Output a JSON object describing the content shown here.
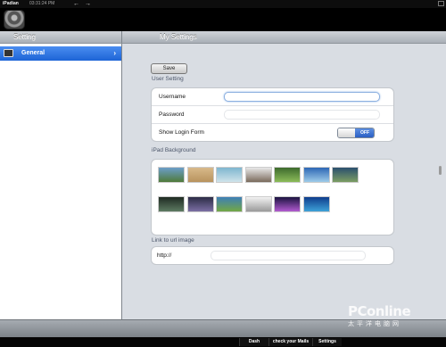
{
  "statusbar": {
    "app": "iPadian",
    "time": "03:31:24 PM",
    "arrows": "← →"
  },
  "sidebar": {
    "title": "Setting",
    "items": [
      {
        "label": "General",
        "selected": true
      }
    ]
  },
  "main": {
    "title": "My Settings",
    "save_label": "Save",
    "user_setting": {
      "title": "User Setting",
      "username_label": "Username",
      "username_value": "",
      "password_label": "Password",
      "password_value": "",
      "login_form_label": "Show Login Form",
      "login_form_state": "OFF"
    },
    "background": {
      "title": "iPad Background",
      "thumbnails": [
        {
          "name": "landscape-field",
          "colors": [
            "#6c9ec9",
            "#4f7a3a"
          ]
        },
        {
          "name": "wood-panel",
          "colors": [
            "#d8b98a",
            "#b8935e"
          ]
        },
        {
          "name": "blue-swirl",
          "colors": [
            "#7eb6cf",
            "#cfe3ea"
          ]
        },
        {
          "name": "room-interior",
          "colors": [
            "#e8e8e8",
            "#7a6a5c"
          ]
        },
        {
          "name": "green-hills",
          "colors": [
            "#3d6a2d",
            "#8cbc5a"
          ]
        },
        {
          "name": "blue-sky",
          "colors": [
            "#2d67b5",
            "#9ecbe9"
          ]
        },
        {
          "name": "tropical",
          "colors": [
            "#2a4f6e",
            "#7c9d63"
          ]
        },
        {
          "name": "dark-forest",
          "colors": [
            "#1f2a22",
            "#5d7a62"
          ]
        },
        {
          "name": "night-stars",
          "colors": [
            "#2c2c46",
            "#7b6fa4"
          ]
        },
        {
          "name": "green-meadow",
          "colors": [
            "#3e7fb6",
            "#73a844"
          ]
        },
        {
          "name": "grey-gradient",
          "colors": [
            "#f2f2f2",
            "#9a9a9a"
          ]
        },
        {
          "name": "purple-aurora",
          "colors": [
            "#1b1340",
            "#b25ad0"
          ]
        },
        {
          "name": "blue-bubbles",
          "colors": [
            "#0f3d8c",
            "#3fa2d8"
          ]
        }
      ]
    },
    "link": {
      "title": "Link to url image",
      "label": "http://",
      "value": ""
    }
  },
  "footer": {
    "tabs": [
      "Dash",
      "check your Mails",
      "Settings"
    ]
  },
  "watermark": {
    "main": "PConline",
    "sub": "太平洋电脑网"
  }
}
